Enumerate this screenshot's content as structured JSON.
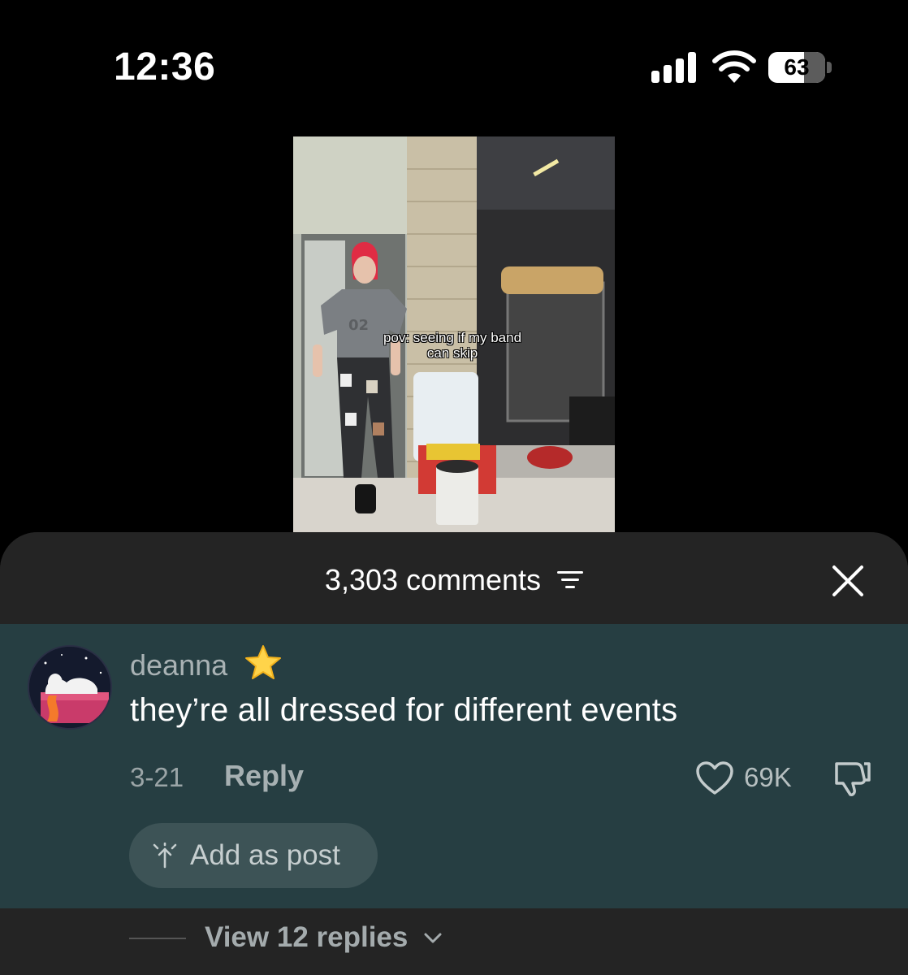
{
  "status_bar": {
    "time": "12:36",
    "battery_percent": "63",
    "icons": [
      "signal-icon",
      "wifi-icon",
      "battery-icon"
    ]
  },
  "video": {
    "caption_line1": "pov: seeing if my band",
    "caption_line2": "can skip"
  },
  "comments_sheet": {
    "count_label": "3,303 comments",
    "icons": [
      "filter-icon",
      "close-icon"
    ]
  },
  "comment": {
    "username": "deanna",
    "text": "they’re all dressed for different events",
    "date": "3-21",
    "reply_label": "Reply",
    "like_count": "69K",
    "add_post_label": "Add as post",
    "view_replies_label": "View 12 replies",
    "icons": [
      "star-icon",
      "heart-icon",
      "dislike-icon",
      "add-post-icon",
      "chevron-down-icon"
    ]
  },
  "colors": {
    "background": "#000000",
    "sheet": "#242424",
    "highlighted_comment": "#263e42",
    "chip": "#3d5356"
  }
}
